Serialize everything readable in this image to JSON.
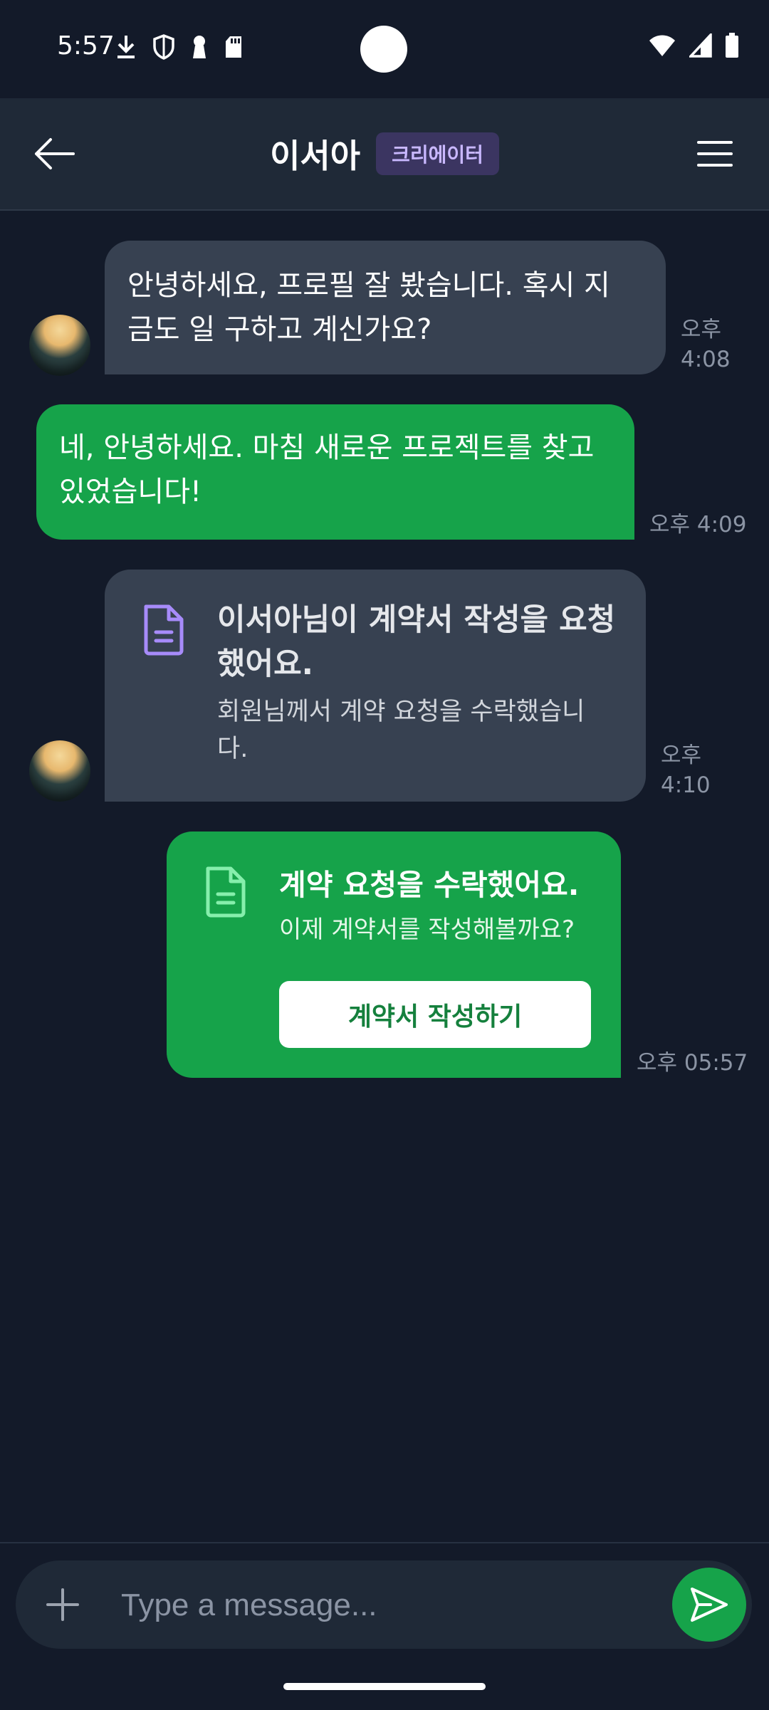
{
  "status_bar": {
    "time": "5:57",
    "left_icons": [
      "download-icon",
      "shield-icon",
      "keyhole-icon",
      "sd-card-icon"
    ],
    "right_icons": [
      "wifi-icon",
      "cell-signal-icon",
      "battery-icon"
    ]
  },
  "header": {
    "name": "이서아",
    "badge": "크리에이터",
    "badge_color": "#3b3561",
    "icons": [
      "arrow-left-icon",
      "hamburger-menu-icon"
    ]
  },
  "messages": [
    {
      "direction": "incoming",
      "text_lines": [
        "안녕하세요, 프로필 잘 봤습니다. 혹시 지",
        "금도 일 구하고 계신가요?"
      ],
      "time_lines": [
        "오후",
        "4:08"
      ]
    },
    {
      "direction": "outgoing",
      "text_lines": [
        "네, 안녕하세요. 마침 새로운 프로젝트를 찾고",
        "있었습니다!"
      ],
      "time": "오후 4:09"
    },
    {
      "direction": "incoming",
      "type": "contract-request-card",
      "icon": "document-icon",
      "title_lines": [
        "이서아님이 계약서 작성을 요청",
        "했어요."
      ],
      "sub_lines": [
        "회원님께서 계약 요청을 수락했습니",
        "다."
      ],
      "time_lines": [
        "오후",
        "4:10"
      ]
    },
    {
      "direction": "outgoing",
      "type": "contract-accepted-card",
      "icon": "document-icon",
      "title": "계약 요청을 수락했어요.",
      "sub": "이제 계약서를 작성해볼까요?",
      "button": "계약서 작성하기",
      "time": "오후 05:57"
    }
  ],
  "composer": {
    "placeholder": "Type a message...",
    "icons": [
      "plus-icon",
      "send-icon"
    ]
  },
  "colors": {
    "background": "#131a29",
    "incoming_bubble": "#374151",
    "outgoing_bubble": "#16a34a",
    "accent_purple": "#a78bfa"
  }
}
